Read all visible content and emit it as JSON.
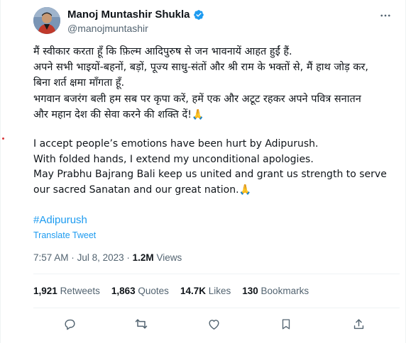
{
  "tweet": {
    "author": {
      "display_name": "Manoj Muntashir Shukla",
      "handle": "@manojmuntashir",
      "verified": true
    },
    "text_hindi": [
      "मैं स्वीकार करता हूँ कि फ़िल्म आदिपुरुष से जन भावनायें आहत हुईं हैं.",
      "अपने सभी भाइयों-बहनों, बड़ों, पूज्य साधु-संतों और श्री राम के भक्तों से, मैं हाथ जोड़ कर,",
      "बिना शर्त क्षमा माँगता हूँ.",
      "भगवान बजरंग बली हम सब पर कृपा करें, हमें एक और अटूट रहकर अपने पवित्र सनातन",
      "और महान देश की सेवा करने की शक्ति दें!"
    ],
    "text_english": [
      "I accept people’s emotions have been hurt by Adipurush.",
      "With folded hands, I extend my unconditional apologies.",
      "May Prabhu Bajrang Bali keep us united and grant us strength to serve",
      "our sacred Sanatan and our great nation."
    ],
    "emoji": "🙏",
    "hashtag": "#Adipurush",
    "translate_label": "Translate Tweet",
    "time": "7:57 AM",
    "separator": "·",
    "date": "Jul 8, 2023",
    "views_count": "1.2M",
    "views_label": "Views",
    "stats": [
      {
        "count": "1,921",
        "label": "Retweets"
      },
      {
        "count": "1,863",
        "label": "Quotes"
      },
      {
        "count": "14.7K",
        "label": "Likes"
      },
      {
        "count": "130",
        "label": "Bookmarks"
      }
    ]
  },
  "colors": {
    "text": "#0f1419",
    "secondary": "#536471",
    "link": "#1d9bf0",
    "divider": "#eff3f4"
  },
  "icons": {
    "more": "more-dots-icon",
    "verified": "verified-badge-icon",
    "actions": [
      "reply-icon",
      "retweet-icon",
      "like-icon",
      "bookmark-icon",
      "share-icon"
    ]
  }
}
